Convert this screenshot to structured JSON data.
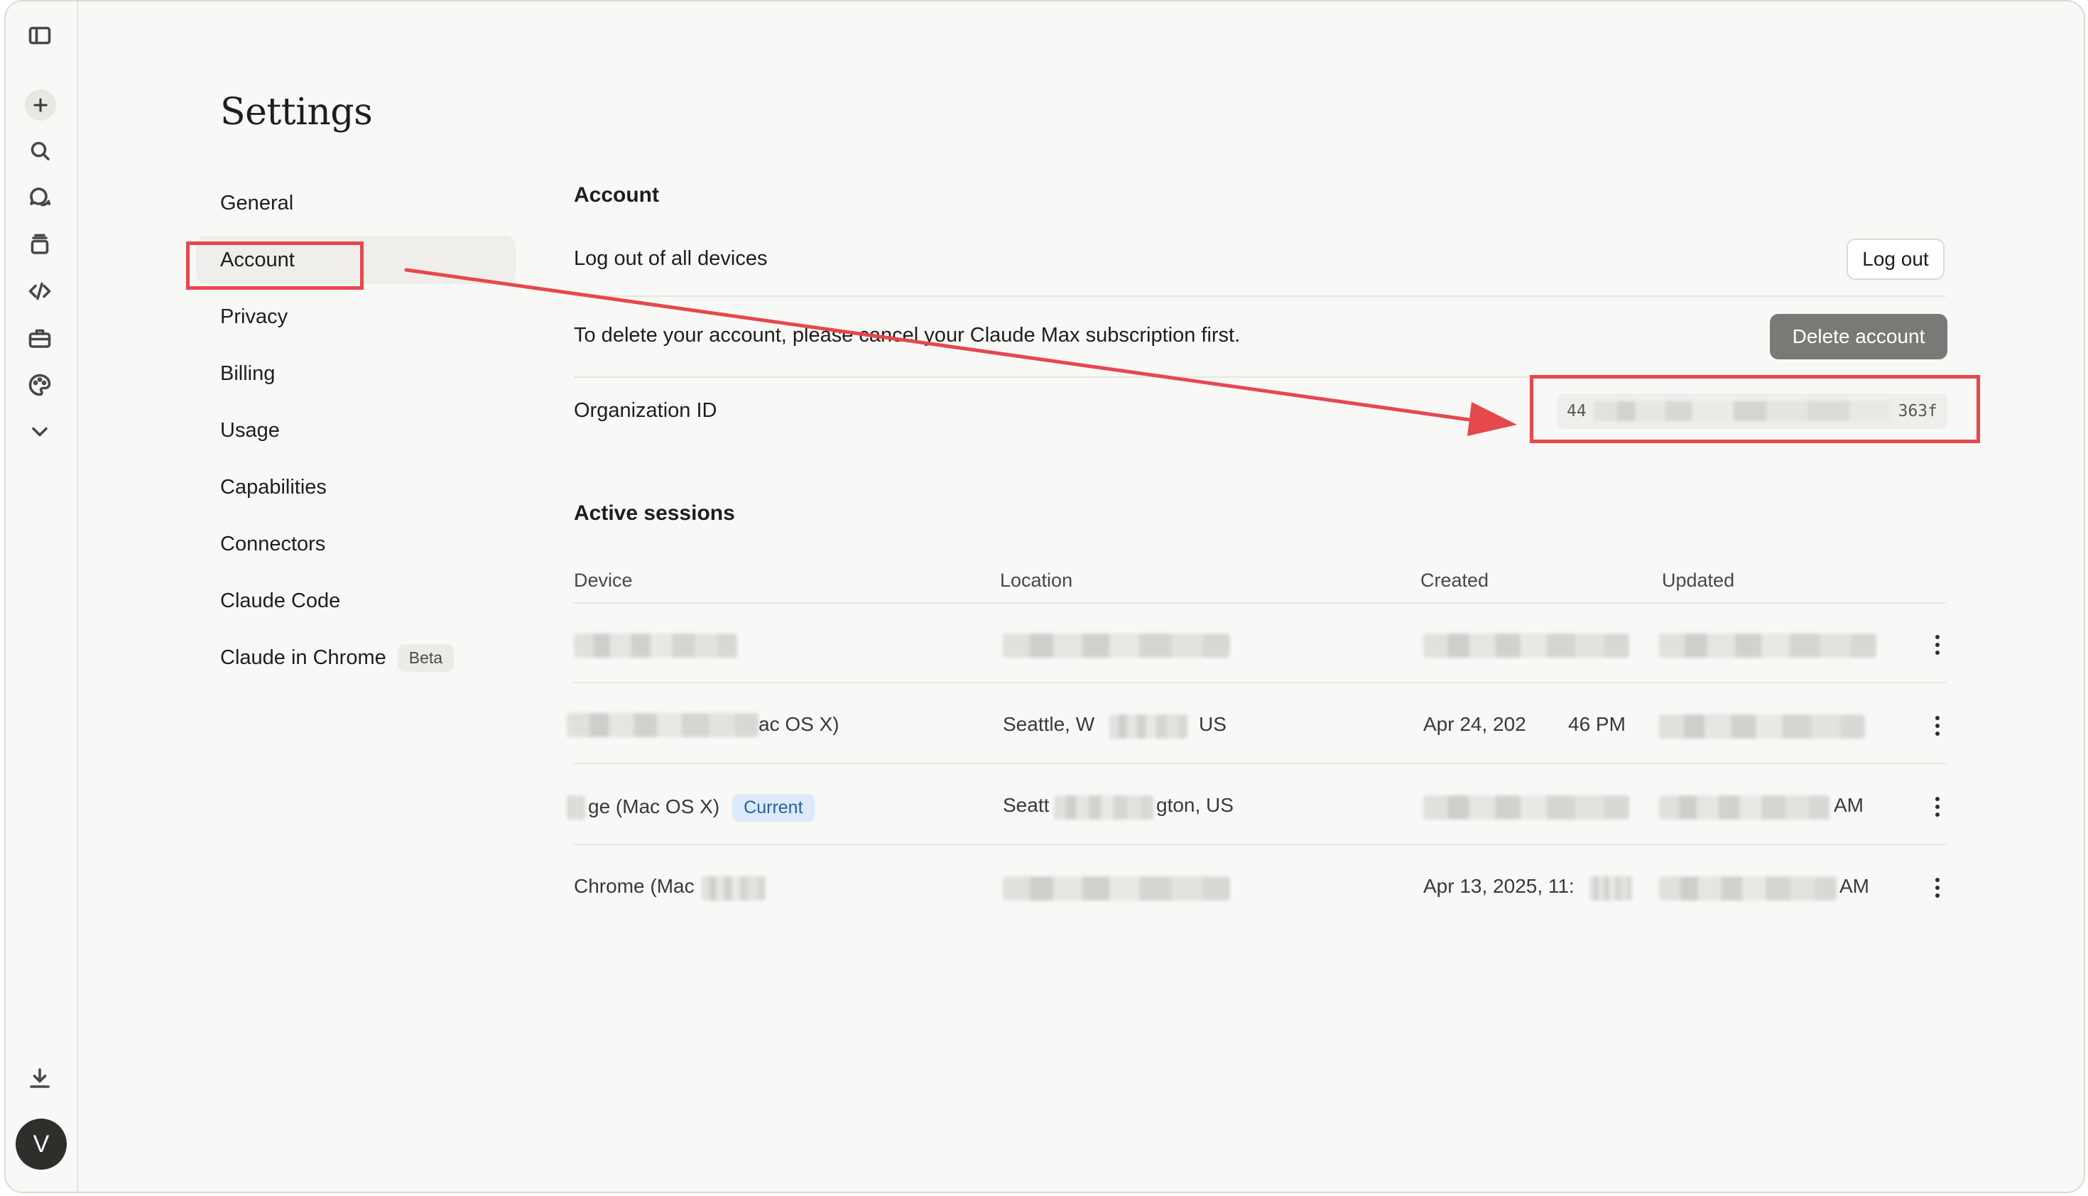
{
  "page": {
    "title": "Settings"
  },
  "rail": {
    "icons": [
      "sidebar-toggle-icon",
      "plus-icon",
      "search-icon",
      "chats-icon",
      "projects-icon",
      "code-icon",
      "artifacts-icon",
      "palette-icon",
      "chevron-down-icon",
      "download-icon"
    ],
    "avatar_letter": "V"
  },
  "nav": {
    "items": [
      {
        "label": "General"
      },
      {
        "label": "Account"
      },
      {
        "label": "Privacy"
      },
      {
        "label": "Billing"
      },
      {
        "label": "Usage"
      },
      {
        "label": "Capabilities"
      },
      {
        "label": "Connectors"
      },
      {
        "label": "Claude Code"
      },
      {
        "label": "Claude in Chrome",
        "badge": "Beta"
      }
    ],
    "active": "Account"
  },
  "account": {
    "heading": "Account",
    "logout_all_label": "Log out of all devices",
    "logout_button": "Log out",
    "delete_note": "To delete your account, please cancel your Claude Max subscription first.",
    "delete_button": "Delete account",
    "org_id_label": "Organization ID",
    "org_id_prefix": "44",
    "org_id_suffix": "363f"
  },
  "sessions": {
    "heading": "Active sessions",
    "columns": [
      "Device",
      "Location",
      "Created",
      "Updated"
    ],
    "rows": [
      {
        "device": "",
        "location": "",
        "created": "",
        "updated": "",
        "current": false
      },
      {
        "device": "ac OS X)",
        "location": "Seattle, W",
        "location_tail": "US",
        "created_head": "Apr 24, 202",
        "created_tail": "46 PM",
        "updated": "",
        "current": false
      },
      {
        "device": "ge (Mac OS X)",
        "location": "Seatt",
        "location_tail": "gton, US",
        "created": "",
        "updated_tail": "AM",
        "current": true,
        "current_label": "Current"
      },
      {
        "device": "Chrome (Mac",
        "location": "",
        "created_head": "Apr 13, 2025, 11:",
        "updated_tail": "AM",
        "current": false
      }
    ]
  },
  "colors": {
    "annotation": "#e5484d",
    "current_badge_bg": "#dceaf9",
    "current_badge_text": "#2b5fa8",
    "delete_button_bg": "#7a7976"
  }
}
